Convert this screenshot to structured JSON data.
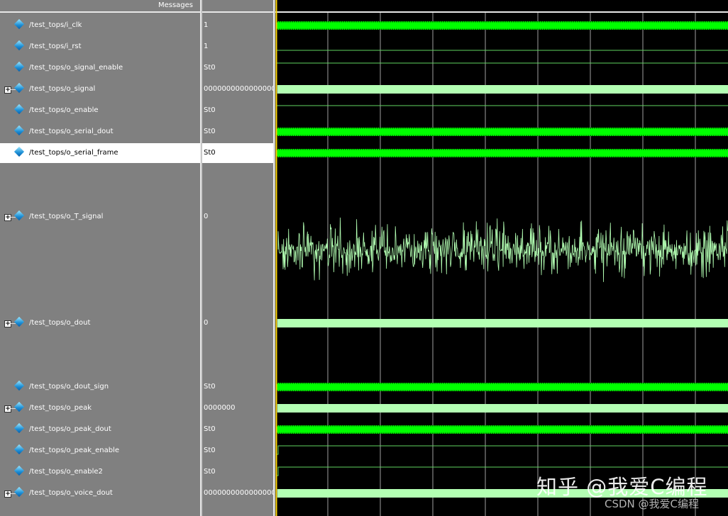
{
  "header": {
    "messages_label": "Messages"
  },
  "colors": {
    "clock": "#00ff00",
    "bus": "#b3ffb3",
    "line": "#5fd35f",
    "grid": "#a0a0a0",
    "cursor": "#ffd700"
  },
  "signals": [
    {
      "name": "/test_tops/i_clk",
      "value": "1",
      "bus": false,
      "wave": "dense"
    },
    {
      "name": "/test_tops/i_rst",
      "value": "1",
      "bus": false,
      "wave": "high"
    },
    {
      "name": "/test_tops/o_signal_enable",
      "value": "St0",
      "bus": false,
      "wave": "low"
    },
    {
      "name": "/test_tops/o_signal",
      "value": "0000000000000000",
      "bus": true,
      "wave": "bus"
    },
    {
      "name": "/test_tops/o_enable",
      "value": "St0",
      "bus": false,
      "wave": "low"
    },
    {
      "name": "/test_tops/o_serial_dout",
      "value": "St0",
      "bus": false,
      "wave": "dense"
    },
    {
      "name": "/test_tops/o_serial_frame",
      "value": "St0",
      "bus": false,
      "wave": "dense",
      "selected": true
    },
    {
      "name": "/test_tops/o_T_signal",
      "value": "0",
      "bus": true,
      "wave": "analog"
    },
    {
      "name": "/test_tops/o_dout",
      "value": "0",
      "bus": true,
      "wave": "bus"
    },
    {
      "name": "/test_tops/o_dout_sign",
      "value": "St0",
      "bus": false,
      "wave": "dense"
    },
    {
      "name": "/test_tops/o_peak",
      "value": "0000000",
      "bus": true,
      "wave": "bus"
    },
    {
      "name": "/test_tops/o_peak_dout",
      "value": "St0",
      "bus": false,
      "wave": "dense"
    },
    {
      "name": "/test_tops/o_peak_enable",
      "value": "St0",
      "bus": false,
      "wave": "step"
    },
    {
      "name": "/test_tops/o_enable2",
      "value": "St0",
      "bus": false,
      "wave": "step"
    },
    {
      "name": "/test_tops/o_voice_dout",
      "value": "0000000000000000",
      "bus": true,
      "wave": "bus"
    }
  ],
  "watermark": {
    "zhihu": "知乎 @我爱C编程",
    "csdn": "CSDN @我爱C编程"
  }
}
